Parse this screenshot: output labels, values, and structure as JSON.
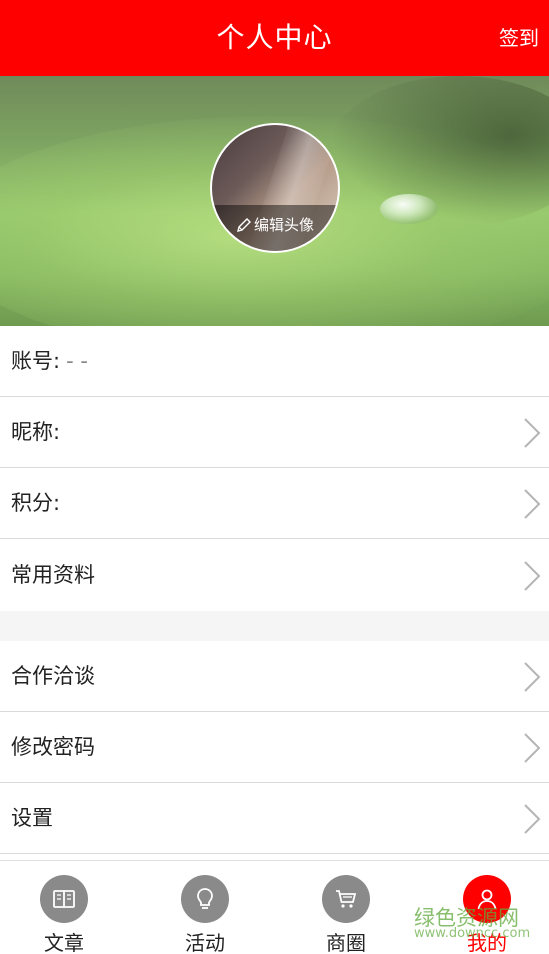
{
  "header": {
    "title": "个人中心",
    "checkin_label": "签到"
  },
  "profile": {
    "edit_avatar_label": "编辑头像"
  },
  "account": {
    "label": "账号:",
    "value": "- -"
  },
  "info_rows": [
    {
      "label": "昵称:"
    },
    {
      "label": "积分:"
    },
    {
      "label": "常用资料"
    }
  ],
  "settings_rows": [
    {
      "label": "合作洽谈"
    },
    {
      "label": "修改密码"
    },
    {
      "label": "设置"
    }
  ],
  "tabs": [
    {
      "label": "文章",
      "icon": "book-icon"
    },
    {
      "label": "活动",
      "icon": "lightbulb-icon"
    },
    {
      "label": "商圈",
      "icon": "cart-icon"
    },
    {
      "label": "我的",
      "icon": "user-icon",
      "active": true
    }
  ],
  "watermark": {
    "text": "绿色资源网",
    "url": "www.downcc.com"
  },
  "colors": {
    "brand": "#ff0000",
    "tab_icon": "#8a8a8a",
    "divider": "#d9d9d9"
  }
}
